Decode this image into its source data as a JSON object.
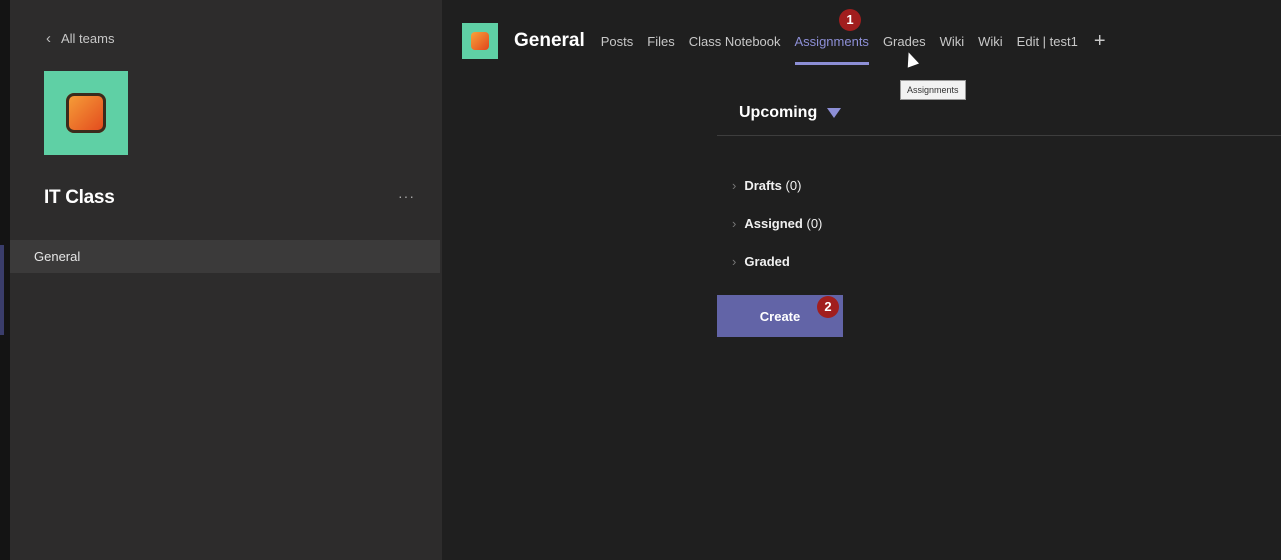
{
  "sidebar": {
    "back_label": "All teams",
    "team_name": "IT Class",
    "more_label": "···",
    "channels": [
      {
        "label": "General"
      }
    ]
  },
  "header": {
    "channel_title": "General",
    "tabs": [
      {
        "label": "Posts"
      },
      {
        "label": "Files"
      },
      {
        "label": "Class Notebook"
      },
      {
        "label": "Assignments"
      },
      {
        "label": "Grades"
      },
      {
        "label": "Wiki"
      },
      {
        "label": "Wiki"
      },
      {
        "label": "Edit | test1"
      }
    ],
    "add_tab_label": "+",
    "tooltip": "Assignments"
  },
  "assignments": {
    "view_label": "Upcoming",
    "groups": [
      {
        "label": "Drafts",
        "count": "(0)"
      },
      {
        "label": "Assigned",
        "count": "(0)"
      },
      {
        "label": "Graded",
        "count": ""
      }
    ],
    "create_label": "Create"
  },
  "annotations": {
    "badge1": "1",
    "badge2": "2"
  },
  "colors": {
    "accent": "#6264a7",
    "team_tile": "#5fd0a5",
    "badge": "#a11e1e"
  }
}
